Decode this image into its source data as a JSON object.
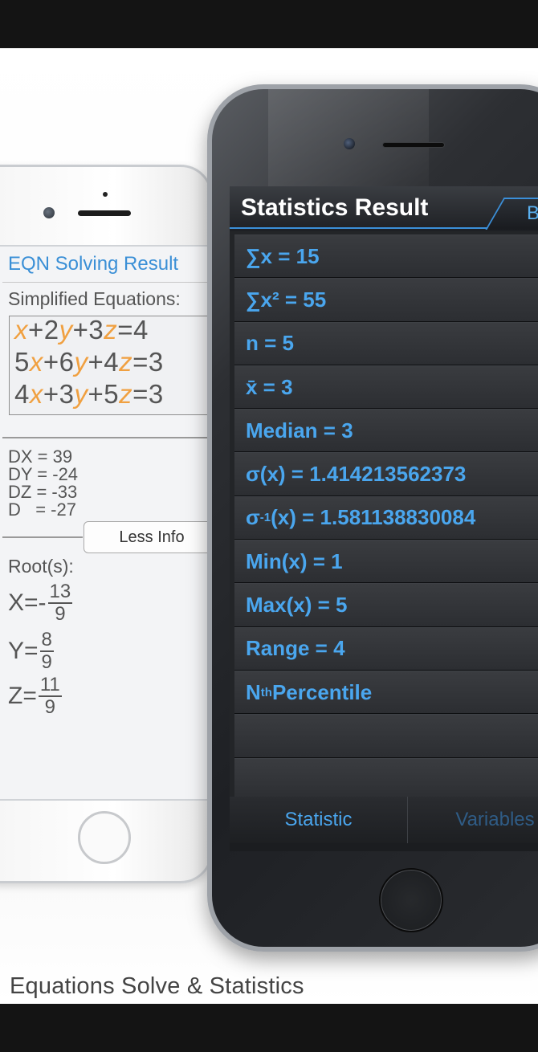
{
  "caption": "Equations Solve & Statistics",
  "left_phone": {
    "title": "EQN Solving Result",
    "simplified_label": "Simplified Equations:",
    "equations": [
      [
        {
          "v": "x",
          "t": "var"
        },
        {
          "v": "+2",
          "t": "n"
        },
        {
          "v": "y",
          "t": "var"
        },
        {
          "v": "+3",
          "t": "n"
        },
        {
          "v": "z",
          "t": "var"
        },
        {
          "v": "=4",
          "t": "n"
        }
      ],
      [
        {
          "v": "5",
          "t": "n"
        },
        {
          "v": "x",
          "t": "var"
        },
        {
          "v": "+6",
          "t": "n"
        },
        {
          "v": "y",
          "t": "var"
        },
        {
          "v": "+4",
          "t": "n"
        },
        {
          "v": "z",
          "t": "var"
        },
        {
          "v": "=3",
          "t": "n"
        }
      ],
      [
        {
          "v": "4",
          "t": "n"
        },
        {
          "v": "x",
          "t": "var"
        },
        {
          "v": "+3",
          "t": "n"
        },
        {
          "v": "y",
          "t": "var"
        },
        {
          "v": "+5",
          "t": "n"
        },
        {
          "v": "z",
          "t": "var"
        },
        {
          "v": "=3",
          "t": "n"
        }
      ]
    ],
    "determinants": [
      "DX = 39",
      "DY = -24",
      "DZ = -33",
      "D   = -27"
    ],
    "less_info_label": "Less Info",
    "roots_label": "Root(s):",
    "roots": [
      {
        "prefix": "X=-",
        "num": "13",
        "den": "9"
      },
      {
        "prefix": "Y=",
        "num": "8",
        "den": "9"
      },
      {
        "prefix": "Z=",
        "num": "11",
        "den": "9"
      }
    ]
  },
  "right_phone": {
    "title": "Statistics Result",
    "back_label": "B",
    "rows": [
      {
        "html": "∑x = 15"
      },
      {
        "html": "∑x² = 55"
      },
      {
        "html": "n = 5"
      },
      {
        "html": "x̄ = 3"
      },
      {
        "html": "Median = 3"
      },
      {
        "html": "σ(x) = 1.414213562373"
      },
      {
        "html": "σ<sub class='s'>-1</sub>(x) = 1.581138830084"
      },
      {
        "html": "Min(x) = 1"
      },
      {
        "html": "Max(x) = 5"
      },
      {
        "html": "Range = 4"
      },
      {
        "html": "N<sup class='s'>th</sup> Percentile"
      },
      {
        "html": ""
      },
      {
        "html": ""
      }
    ],
    "tabs": [
      {
        "label": "Statistic",
        "active": true
      },
      {
        "label": "Variables",
        "active": false
      }
    ]
  },
  "colors": {
    "accent_blue": "#4aa6ee",
    "variable_orange": "#f0a040",
    "eqn_title_blue": "#3a8fd6"
  }
}
